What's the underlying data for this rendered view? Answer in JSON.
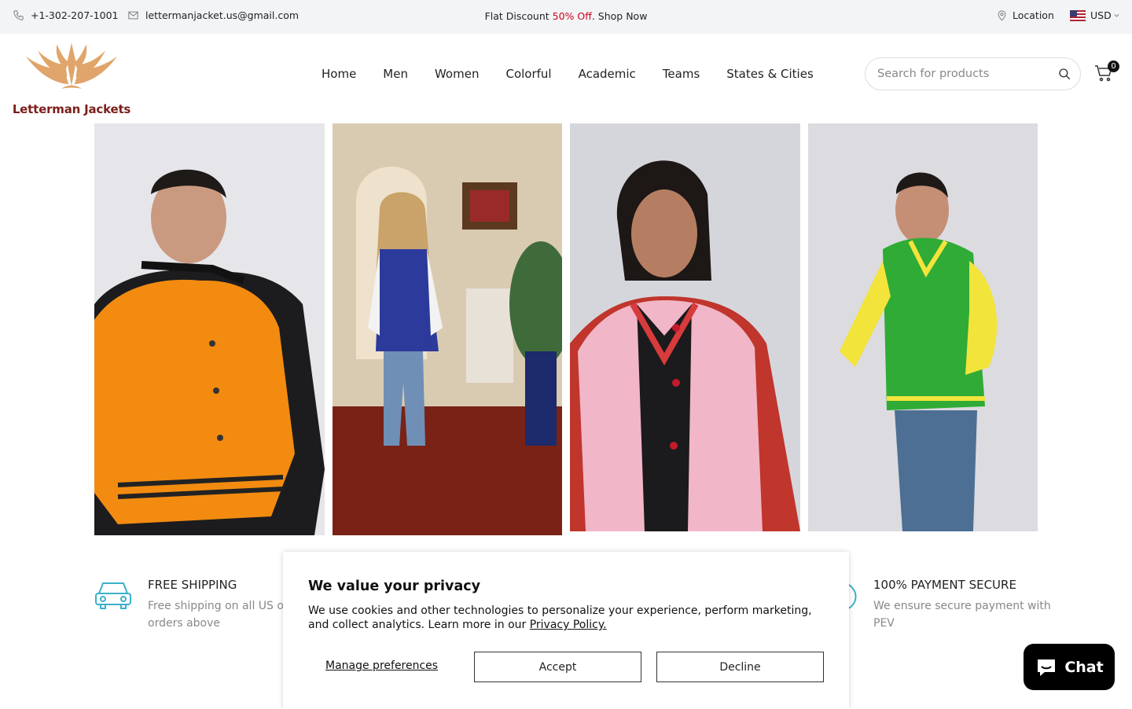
{
  "topbar": {
    "phone": "+1-302-207-1001",
    "email": "lettermanjacket.us@gmail.com",
    "promo_prefix": "Flat Discount ",
    "promo_highlight": "50% Off",
    "promo_suffix": ". Shop Now",
    "location": "Location",
    "currency": "USD"
  },
  "header": {
    "logo_text": "Letterman Jackets",
    "nav": [
      "Home",
      "Men",
      "Women",
      "Colorful",
      "Academic",
      "Teams",
      "States & Cities"
    ],
    "search_placeholder": "Search for products",
    "cart_count": "0"
  },
  "features": [
    {
      "title": "FREE SHIPPING",
      "desc": "Free shipping on all US orders or orders above"
    },
    {
      "title": "100% PAYMENT SECURE",
      "desc": "We ensure secure payment with PEV"
    }
  ],
  "cookie": {
    "title": "We value your privacy",
    "text": "We use cookies and other technologies to personalize your experience, perform marketing, and collect analytics. Learn more in our ",
    "link": "Privacy Policy.",
    "manage": "Manage preferences",
    "accept": "Accept",
    "decline": "Decline"
  },
  "chat": {
    "label": "Chat"
  },
  "colors": {
    "accent_red": "#d0021b",
    "logo_red": "#7b1f1a",
    "logo_gold": "#e0a56a",
    "feature_icon": "#3bb0c9"
  }
}
